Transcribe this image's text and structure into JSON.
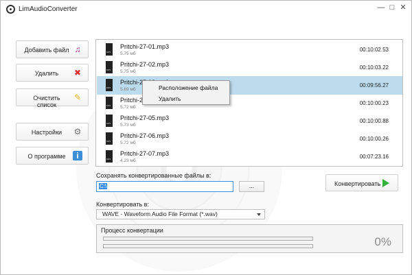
{
  "window": {
    "title": "LimAudioConverter",
    "min_glyph": "—",
    "max_glyph": "□",
    "close_glyph": "✕"
  },
  "sidebar": {
    "items": [
      {
        "label": "Добавить файл",
        "icon": "music-note-icon"
      },
      {
        "label": "Удалить",
        "icon": "delete-x-icon"
      },
      {
        "label": "Очистить список",
        "icon": "broom-icon"
      },
      {
        "label": "Настройки",
        "icon": "gear-icon"
      },
      {
        "label": "О программе",
        "icon": "info-icon"
      }
    ],
    "icon_glyphs": [
      "♫",
      "✖",
      "✎",
      "⚙",
      "i"
    ]
  },
  "files": [
    {
      "name": "Pritchi-27-01.mp3",
      "size": "5.75 мб",
      "duration": "00:10:02.53"
    },
    {
      "name": "Pritchi-27-02.mp3",
      "size": "5.75 мб",
      "duration": "00:10:03.22"
    },
    {
      "name": "Pritchi-27-03.mp3",
      "size": "5.69 мб",
      "duration": "00:09:56.27",
      "selected": true
    },
    {
      "name": "Pritchi-27-04.mp3",
      "size": "5.72 мб",
      "duration": "00:10:00.23"
    },
    {
      "name": "Pritchi-27-05.mp3",
      "size": "5.73 мб",
      "duration": "00:10:00.88"
    },
    {
      "name": "Pritchi-27-06.mp3",
      "size": "5.72 мб",
      "duration": "00:10:00.26"
    },
    {
      "name": "Pritchi-27-07.mp3",
      "size": "4.23 мб",
      "duration": "00:07:23.16"
    }
  ],
  "context_menu": {
    "items": [
      "Расположение файла",
      "Удалить"
    ]
  },
  "save": {
    "label": "Сохранять конвертированные файлы в:",
    "value": "C:\\",
    "browse_label": "..."
  },
  "convert": {
    "label": "Конвертировать",
    "accent": "#33b23b"
  },
  "format": {
    "label": "Конвертировать в:",
    "selected": "WAVE - Waveform Audio File Format (*.wav)"
  },
  "progress": {
    "title": "Процесс конвертации",
    "percent_text": "0%",
    "value": 0
  },
  "colors": {
    "selection": "#bcdcee",
    "input_focus": "#3a8ee6"
  }
}
